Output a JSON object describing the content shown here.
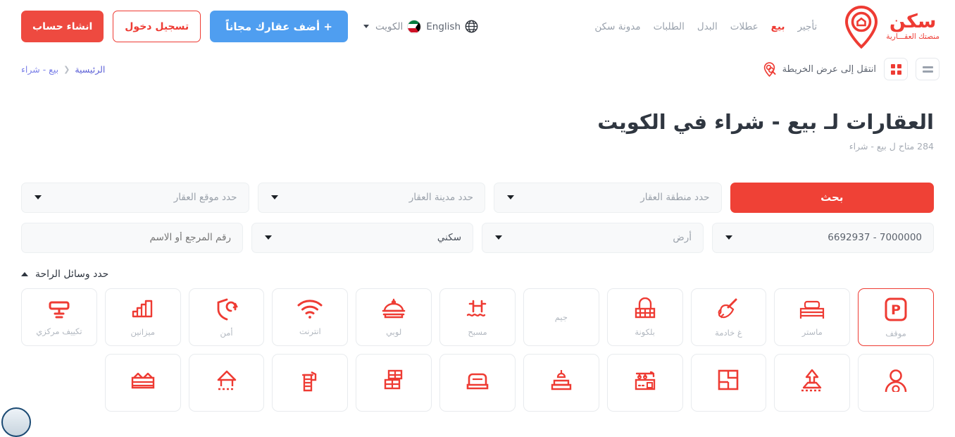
{
  "header": {
    "brand": {
      "name": "سكن",
      "tagline": "منصتك العقـــارية",
      "logo_icon": "location-pin-logo"
    },
    "nav": [
      {
        "label": "تأجير",
        "active": false
      },
      {
        "label": "بيع",
        "active": true
      },
      {
        "label": "عطلات",
        "active": false
      },
      {
        "label": "البدل",
        "active": false
      },
      {
        "label": "الطلبات",
        "active": false
      },
      {
        "label": "مدونة سكن",
        "active": false
      }
    ],
    "language": {
      "icon": "globe-icon",
      "label": "English"
    },
    "country": {
      "flag": "kuwait-flag-icon",
      "label": "الكويت",
      "caret": "chevron-down-icon"
    },
    "buttons": {
      "add_property": "+ أضف عقارك مجاناً",
      "login": "تسجيل دخول",
      "signup": "انشاء حساب"
    },
    "colors": {
      "brand_red": "#ee3b33",
      "blue": "#4f9ef0",
      "signup_red": "#ee4a40"
    }
  },
  "subbar": {
    "breadcrumb": {
      "home": "الرئيسية",
      "separator": "❮",
      "current": "بيع - شراء"
    },
    "map_link": {
      "icon": "map-search-pin-icon",
      "label": "انتقل إلى عرض الخريطة"
    },
    "view_toggle": {
      "grid_icon": "grid-view-icon",
      "list_icon": "list-view-icon",
      "active": "grid"
    }
  },
  "page": {
    "title": "العقارات لـ بيع - شراء في الكويت",
    "subtitle": "284 متاح ل بيع - شراء"
  },
  "search": {
    "row1": [
      {
        "name": "location",
        "value": "",
        "placeholder": "حدد موقع العقار",
        "type": "select"
      },
      {
        "name": "city",
        "value": "",
        "placeholder": "حدد مدينة العقار",
        "type": "select"
      },
      {
        "name": "district",
        "value": "",
        "placeholder": "حدد منطقة العقار",
        "type": "select"
      }
    ],
    "row2": [
      {
        "name": "reference",
        "value": "",
        "placeholder": "رقم المرجع أو الاسم",
        "type": "text"
      },
      {
        "name": "category",
        "value": "سكني",
        "placeholder": "سكني",
        "type": "select"
      },
      {
        "name": "property_type",
        "value": "",
        "placeholder": "أرض",
        "type": "select"
      },
      {
        "name": "price_range",
        "value": "7000000 - 6692937",
        "placeholder": "",
        "type": "select"
      }
    ],
    "submit_label": "بحث"
  },
  "amenities": {
    "header_label": "حدد وسائل الراحة",
    "collapse_icon": "chevron-up-icon",
    "items": [
      {
        "label": "موقف",
        "icon": "parking-icon",
        "selected": true
      },
      {
        "label": "ماستر",
        "icon": "bed-icon",
        "selected": false
      },
      {
        "label": "غ خادمة",
        "icon": "maid-duster-icon",
        "selected": false
      },
      {
        "label": "بلكونة",
        "icon": "balcony-icon",
        "selected": false
      },
      {
        "label": "جيم",
        "icon": "",
        "selected": false
      },
      {
        "label": "مسبح",
        "icon": "swimming-pool-icon",
        "selected": false
      },
      {
        "label": "لوبي",
        "icon": "lobby-bell-icon",
        "selected": false
      },
      {
        "label": "انترنت",
        "icon": "wifi-icon",
        "selected": false
      },
      {
        "label": "أمن",
        "icon": "shield-security-icon",
        "selected": false
      },
      {
        "label": "ميزانين",
        "icon": "stairs-mezzanine-icon",
        "selected": false
      },
      {
        "label": "تكييف مركزي",
        "icon": "air-conditioner-icon",
        "selected": false
      },
      {
        "label": "",
        "icon": "person-avatar-icon",
        "selected": false
      },
      {
        "label": "",
        "icon": "house-roof-icon",
        "selected": false
      },
      {
        "label": "",
        "icon": "floor-plan-icon",
        "selected": false
      },
      {
        "label": "",
        "icon": "kitchen-icon",
        "selected": false
      },
      {
        "label": "",
        "icon": "living-room-icon",
        "selected": false
      },
      {
        "label": "",
        "icon": "sofa-icon",
        "selected": false
      },
      {
        "label": "",
        "icon": "furniture-icon",
        "selected": false
      },
      {
        "label": "",
        "icon": "elevator-building-icon",
        "selected": false
      },
      {
        "label": "",
        "icon": "terrace-house-icon",
        "selected": false
      },
      {
        "label": "",
        "icon": "duplex-houses-icon",
        "selected": false
      }
    ]
  },
  "accessibility_widget": {
    "icon": "accessibility-icon"
  }
}
